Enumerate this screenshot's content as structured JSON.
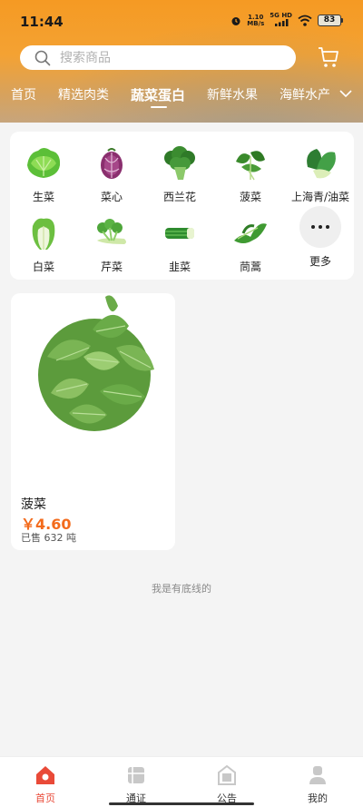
{
  "status_bar": {
    "time": "11:44",
    "net_speed": "1.10",
    "net_unit": "MB/s",
    "signal_label": "5G HD",
    "battery": "83"
  },
  "search": {
    "placeholder": "搜索商品"
  },
  "categories": [
    {
      "label": "首页",
      "active": false
    },
    {
      "label": "精选肉类",
      "active": false
    },
    {
      "label": "蔬菜蛋白",
      "active": true
    },
    {
      "label": "新鲜水果",
      "active": false
    },
    {
      "label": "海鲜水产",
      "active": false
    }
  ],
  "vegetables": [
    {
      "label": "生菜",
      "icon": "lettuce-icon"
    },
    {
      "label": "菜心",
      "icon": "purple-cabbage-icon"
    },
    {
      "label": "西兰花",
      "icon": "broccoli-icon"
    },
    {
      "label": "菠菜",
      "icon": "spinach-icon"
    },
    {
      "label": "上海青/油菜",
      "icon": "bok-choy-icon"
    },
    {
      "label": "白菜",
      "icon": "napa-cabbage-icon"
    },
    {
      "label": "芹菜",
      "icon": "celery-icon"
    },
    {
      "label": "韭菜",
      "icon": "chives-icon"
    },
    {
      "label": "茼蒿",
      "icon": "crown-daisy-icon"
    },
    {
      "label": "更多",
      "icon": "more-icon"
    }
  ],
  "products": [
    {
      "name": "菠菜",
      "price": "￥4.60",
      "sold": "已售 632 吨"
    }
  ],
  "bottom_text": "我是有底线的",
  "tabbar": [
    {
      "label": "首页",
      "icon": "home-icon",
      "active": true
    },
    {
      "label": "通证",
      "icon": "token-icon",
      "active": false
    },
    {
      "label": "公告",
      "icon": "notice-icon",
      "active": false
    },
    {
      "label": "我的",
      "icon": "profile-icon",
      "active": false
    }
  ],
  "colors": {
    "header": "#f59a23",
    "accent": "#e94a38",
    "price": "#f36b1c",
    "background": "#f4f4f4"
  }
}
